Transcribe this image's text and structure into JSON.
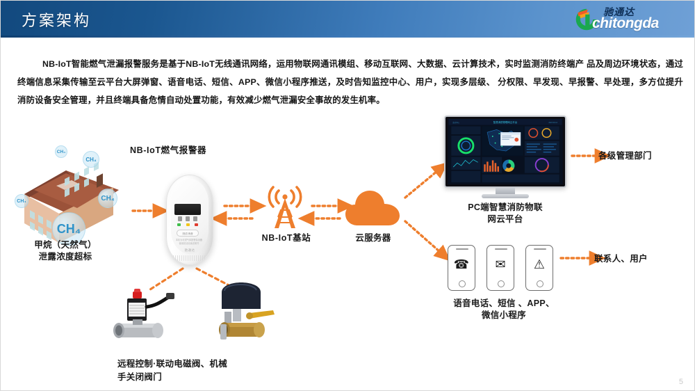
{
  "header": {
    "title": "方案架构",
    "logo_cn": "驰通达",
    "logo_en": "chitongda",
    "logo_icon": "circular-arrow-logo-icon"
  },
  "body": {
    "paragraph": "NB-IoT智能燃气泄漏报警服务是基于NB-IoT无线通讯网络，运用物联网通讯模组、移动互联网、大数据、云计算技术，实时监测消防终端产  品及周边环境状态，通过终端信息采集传输至云平台大屏弹窗、语音电话、短信、APP、微信小程序推送，及时告知监控中心、用户，实现多层级、 分权限、早发现、早报警、早处理，多方位提升消防设备安全管理，并且终端具备危情自动处置功能，有效减少燃气泄漏安全事故的发生机率。"
  },
  "diagram": {
    "nodes": [
      {
        "id": "house",
        "label": "甲烷（天然气）\n泄露浓度超标",
        "icon": "house-gas-leak-icon"
      },
      {
        "id": "alarm",
        "label": "NB-IoT燃气报警器",
        "icon": "gas-alarm-device-icon"
      },
      {
        "id": "tower",
        "label": "NB-IoT基站",
        "icon": "cell-tower-icon"
      },
      {
        "id": "cloud",
        "label": "云服务器",
        "icon": "cloud-server-icon"
      },
      {
        "id": "monitor",
        "label": "PC端智慧消防物联\n网云平台",
        "icon": "desktop-monitor-icon"
      },
      {
        "id": "admin",
        "label": "各级管理部门",
        "icon": "text-label"
      },
      {
        "id": "phones",
        "label": "语音电话、短信 、APP、\n微信小程序",
        "icon": "mobile-phones-icon"
      },
      {
        "id": "contact",
        "label": "联系人、用户",
        "icon": "text-label"
      },
      {
        "id": "valves",
        "label": "远程控制·联动电磁阀、机械\n手关闭阀门",
        "icon": "solenoid-valve-icon"
      }
    ],
    "bubbles": [
      {
        "text": "CH₄",
        "size": "lg"
      },
      {
        "text": "CH₄",
        "size": "md"
      },
      {
        "text": "CH₄",
        "size": "sm"
      },
      {
        "text": "CH₄",
        "size": "sm"
      },
      {
        "text": "CH₄",
        "size": "xs"
      }
    ],
    "phone_glyphs": [
      "call-icon",
      "envelope-icon",
      "alert-triangle-icon"
    ],
    "alarm_device": {
      "button_label": "测试/消音",
      "caption_line1": "本机为可燃气体报警探测器",
      "caption_line2": "使用前请阅读说明书",
      "brand": "驰通达"
    }
  },
  "colors": {
    "header_dark": "#12497e",
    "header_light": "#6fa0d6",
    "accent_orange": "#ee7e2d",
    "bubble_blue": "#2f93c9",
    "text_dark": "#161616"
  },
  "footer": {
    "page_number": "5"
  }
}
